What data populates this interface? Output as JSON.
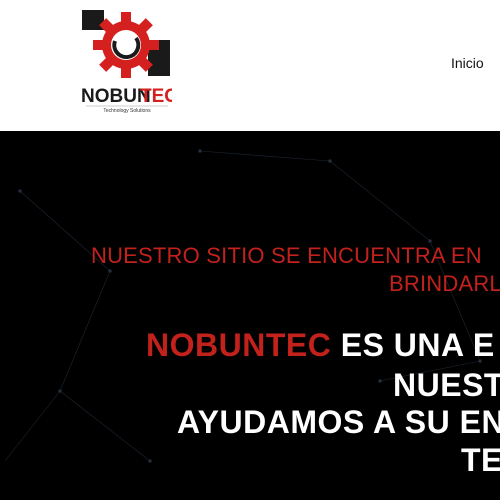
{
  "header": {
    "logo": {
      "brand_prefix": "NOBUN",
      "brand_suffix": "TEC",
      "tagline": "Technology Solutions",
      "icon": "gear-icon",
      "colors": {
        "gear": "#d4201e",
        "dark": "#1a1a1a"
      }
    },
    "nav": {
      "inicio": "Inicio"
    }
  },
  "hero": {
    "notice_line1": "NUESTRO SITIO SE ENCUENTRA EN",
    "notice_line2": "BRINDARL",
    "headline": {
      "brand": "NOBUNTEC",
      "line1_rest": " ES UNA E",
      "line2": "NUEST",
      "line3": "AYUDAMOS A SU EN",
      "line4": "TE"
    },
    "colors": {
      "accent": "#c2211c",
      "text": "#ffffff",
      "background": "#000000"
    }
  }
}
